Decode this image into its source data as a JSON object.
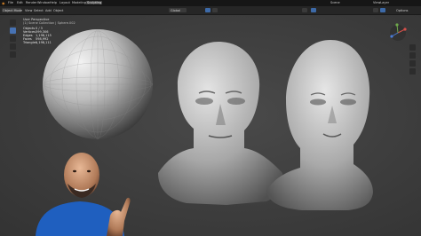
{
  "menubar": {
    "menus": [
      "File",
      "Edit",
      "Render",
      "Window",
      "Help"
    ],
    "workspace_tabs": [
      "Layout",
      "Modeling",
      "Sculpting"
    ],
    "scene": "Scene",
    "view_layer": "ViewLayer"
  },
  "header": {
    "mode": "Object Mode",
    "menus": [
      "View",
      "Select",
      "Add",
      "Object"
    ],
    "transform": "Global",
    "options": "Options"
  },
  "viewport": {
    "view_name": "User Perspective",
    "collection_path": "(1) Scene Collection | Sphere.002",
    "stats": [
      {
        "label": "Objects",
        "value": "0 / 3"
      },
      {
        "label": "Vertices",
        "value": "599,306"
      },
      {
        "label": "Edges",
        "value": "1,198,115"
      },
      {
        "label": "Faces",
        "value": "598,992"
      },
      {
        "label": "Triangles",
        "value": "1,198,111"
      }
    ]
  },
  "colors": {
    "accent": "#4772b3",
    "header": "#262626",
    "viewport": "#3d3d3d"
  },
  "icons": [
    "gear-icon",
    "move-icon",
    "rotate-icon",
    "scale-icon",
    "hand-icon",
    "zoom-icon",
    "camera-icon",
    "grid-icon"
  ]
}
